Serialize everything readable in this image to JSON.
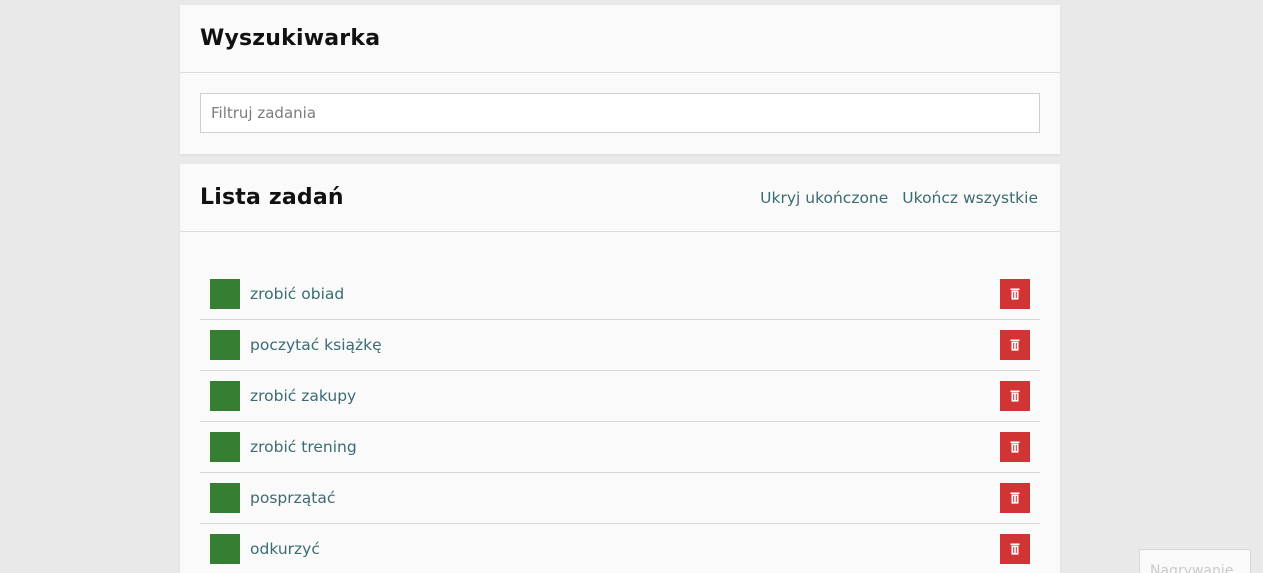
{
  "search_panel": {
    "title": "Wyszukiwarka",
    "filter_placeholder": "Filtruj zadania",
    "filter_value": ""
  },
  "list_panel": {
    "title": "Lista zadań",
    "hide_completed_label": "Ukryj ukończone",
    "complete_all_label": "Ukończ wszystkie",
    "tasks": [
      {
        "label": "zrobić obiad"
      },
      {
        "label": "poczytać książkę"
      },
      {
        "label": "zrobić zakupy"
      },
      {
        "label": "zrobić trening"
      },
      {
        "label": "posprzątać"
      },
      {
        "label": "odkurzyć"
      }
    ]
  },
  "corner_overlay": {
    "text": "Nagrywanie"
  },
  "colors": {
    "background": "#e9e9e9",
    "panel": "#fafafa",
    "link": "#3b6b73",
    "complete_button": "#367f32",
    "delete_button": "#d13434"
  },
  "icons": {
    "delete": "trash-icon"
  }
}
